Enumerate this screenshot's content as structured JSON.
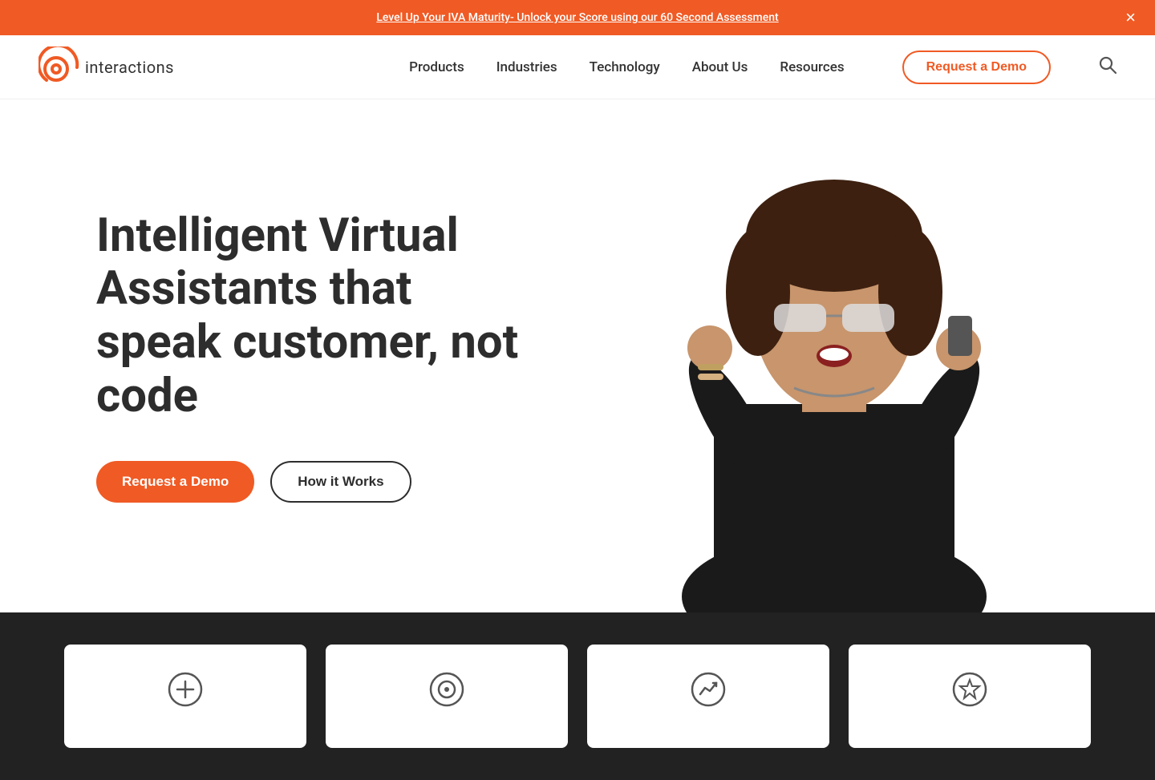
{
  "banner": {
    "text": "Level Up Your IVA Maturity- Unlock your Score using our 60 Second Assessment",
    "close_label": "×"
  },
  "header": {
    "logo_text": "interactions",
    "nav": [
      {
        "label": "Products",
        "id": "products"
      },
      {
        "label": "Industries",
        "id": "industries"
      },
      {
        "label": "Technology",
        "id": "technology"
      },
      {
        "label": "About Us",
        "id": "about"
      },
      {
        "label": "Resources",
        "id": "resources"
      }
    ],
    "demo_button": "Request a Demo",
    "search_icon": "search-icon"
  },
  "hero": {
    "title": "Intelligent Virtual Assistants that speak customer, not code",
    "btn_primary": "Request a Demo",
    "btn_secondary": "How it Works"
  },
  "cards": [
    {
      "id": "card-1",
      "icon": "📥"
    },
    {
      "id": "card-2",
      "icon": "🎯"
    },
    {
      "id": "card-3",
      "icon": "📈"
    },
    {
      "id": "card-4",
      "icon": "⭐"
    }
  ]
}
